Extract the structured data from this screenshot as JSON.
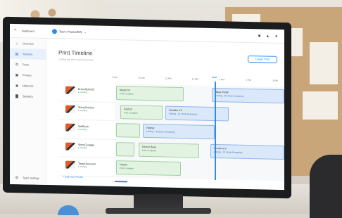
{
  "topbar": {
    "brand": "Dashboard",
    "team_name": "Team: ProductDW",
    "icons": [
      "cart-icon",
      "bell-icon",
      "user-icon"
    ]
  },
  "sidebar": {
    "items": [
      {
        "label": "Overview",
        "icon": "home-icon",
        "active": false
      },
      {
        "label": "Timeline",
        "icon": "timeline-icon",
        "active": true
      },
      {
        "label": "Parts",
        "icon": "part-icon",
        "active": false
      },
      {
        "label": "Printers",
        "icon": "printer-icon",
        "active": false
      },
      {
        "label": "Materials",
        "icon": "material-icon",
        "active": false
      },
      {
        "label": "Statistics",
        "icon": "chart-icon",
        "active": false
      }
    ],
    "footer": "Team Settings"
  },
  "main": {
    "title": "Print Timeline",
    "subtitle": "Looking live view of all print activity",
    "create_button": "Create Print",
    "now_label": "Now",
    "ticks": [
      "9 AM",
      "10 AM",
      "11 AM",
      "12 AM",
      "1 PM",
      "2 PM",
      "3 PM"
    ],
    "add_printer": "+ Add New Printer"
  },
  "printers": [
    {
      "name": "BravaSpiceSt",
      "status": "Printing",
      "jobs": [
        {
          "name": "Model V2",
          "status": "Print Complete",
          "color": "green"
        },
        {
          "name": "Base Pedal",
          "status": "Printing · 3h 45min Remaining",
          "color": "blue"
        }
      ]
    },
    {
      "name": "ShinyChicken",
      "status": "Printing",
      "jobs": [
        {
          "name": "Fold V1",
          "status": "Print Complete",
          "color": "green"
        },
        {
          "name": "Handles V1",
          "status": "Printing · 1h 15min Remaining",
          "color": "blue"
        }
      ]
    },
    {
      "name": "SaltRock",
      "status": "Printing",
      "jobs": [
        {
          "name": "",
          "status": "",
          "color": "green"
        },
        {
          "name": "Helmet",
          "status": "Printing · 4h 20min Remaining",
          "color": "blue"
        }
      ]
    },
    {
      "name": "SpicyGuagge",
      "status": "Printing",
      "jobs": [
        {
          "name": "",
          "status": "",
          "color": "green"
        },
        {
          "name": "Device Base",
          "status": "Print Complete",
          "color": "green"
        },
        {
          "name": "Structure 2",
          "status": "Printing · 3h 45min Remaining",
          "color": "blue"
        }
      ]
    },
    {
      "name": "TastyOpossum",
      "status": "Printing",
      "jobs": [
        {
          "name": "Nozzle",
          "status": "Print Complete",
          "color": "green"
        }
      ]
    }
  ]
}
